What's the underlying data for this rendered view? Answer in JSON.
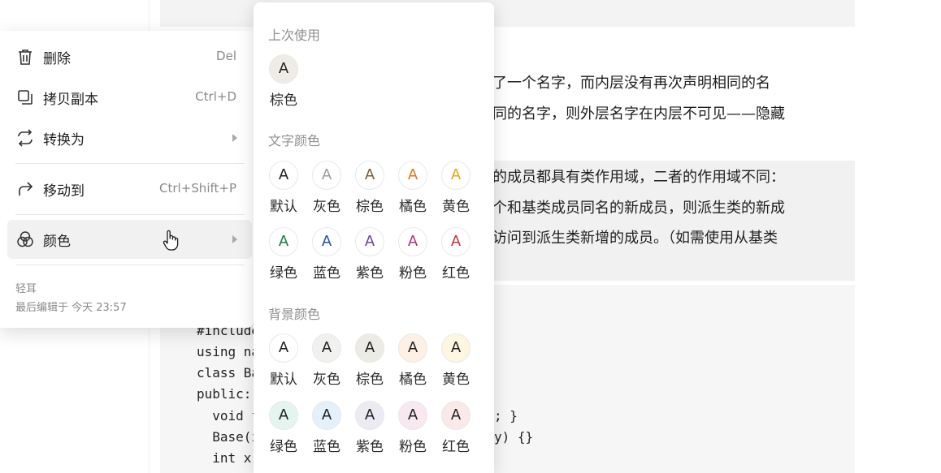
{
  "document": {
    "para1": [
      "声明了一个名字，而内层没有再次声明相同的名",
      "了相同的名字，则外层名字在内层不可见——隐藏"
    ],
    "quote": [
      "新增的成员都具有类作用域，二者的作用域不同：",
      "了一个和基类成员同名的新成员，则派生类的新成",
      "只能访问到派生类新增的成员。（如需使用从基类"
    ],
    "code_left": [
      "#include",
      "using na",
      "class Ba",
      "public:",
      "  void f",
      "  Base(i",
      "  int x,"
    ],
    "code_right": [
      "; }",
      "y) {}"
    ]
  },
  "context_menu": {
    "items": [
      {
        "label": "删除",
        "shortcut": "Del",
        "icon": "trash-icon"
      },
      {
        "label": "拷贝副本",
        "shortcut": "Ctrl+D",
        "icon": "copy-icon"
      },
      {
        "label": "转换为",
        "shortcut": "",
        "icon": "convert-icon"
      },
      {
        "label": "移动到",
        "shortcut": "Ctrl+Shift+P",
        "icon": "move-arrow-icon"
      },
      {
        "label": "颜色",
        "shortcut": "",
        "icon": "color-circles-icon"
      }
    ],
    "footer": {
      "author": "轻耳",
      "edited": "最后编辑于 今天 23:57"
    }
  },
  "color_menu": {
    "recent_title": "上次使用",
    "recent": [
      {
        "label": "棕色",
        "glyph": "A",
        "text_color": "#1f1f1f",
        "bg_color": "#efece8"
      }
    ],
    "text_title": "文字颜色",
    "text_colors": [
      {
        "label": "默认",
        "glyph": "A",
        "color": "#1f1f1f"
      },
      {
        "label": "灰色",
        "glyph": "A",
        "color": "#9b9b9b"
      },
      {
        "label": "棕色",
        "glyph": "A",
        "color": "#7b5b3a"
      },
      {
        "label": "橘色",
        "glyph": "A",
        "color": "#e6731c"
      },
      {
        "label": "黄色",
        "glyph": "A",
        "color": "#e2a90e"
      },
      {
        "label": "绿色",
        "glyph": "A",
        "color": "#197a3f"
      },
      {
        "label": "蓝色",
        "glyph": "A",
        "color": "#1d55a8"
      },
      {
        "label": "紫色",
        "glyph": "A",
        "color": "#6b3fa0"
      },
      {
        "label": "粉色",
        "glyph": "A",
        "color": "#b0307a"
      },
      {
        "label": "红色",
        "glyph": "A",
        "color": "#c1343a"
      }
    ],
    "bg_title": "背景颜色",
    "bg_colors": [
      {
        "label": "默认",
        "glyph": "A",
        "color": "#ffffff"
      },
      {
        "label": "灰色",
        "glyph": "A",
        "color": "#f1f1f0"
      },
      {
        "label": "棕色",
        "glyph": "A",
        "color": "#ecebe6"
      },
      {
        "label": "橘色",
        "glyph": "A",
        "color": "#fdf0e5"
      },
      {
        "label": "黄色",
        "glyph": "A",
        "color": "#fdf6e1"
      },
      {
        "label": "绿色",
        "glyph": "A",
        "color": "#e4f5ef"
      },
      {
        "label": "蓝色",
        "glyph": "A",
        "color": "#e4f1fb"
      },
      {
        "label": "紫色",
        "glyph": "A",
        "color": "#ecebf3"
      },
      {
        "label": "粉色",
        "glyph": "A",
        "color": "#f8e8f0"
      },
      {
        "label": "红色",
        "glyph": "A",
        "color": "#fbe9ea"
      }
    ]
  }
}
